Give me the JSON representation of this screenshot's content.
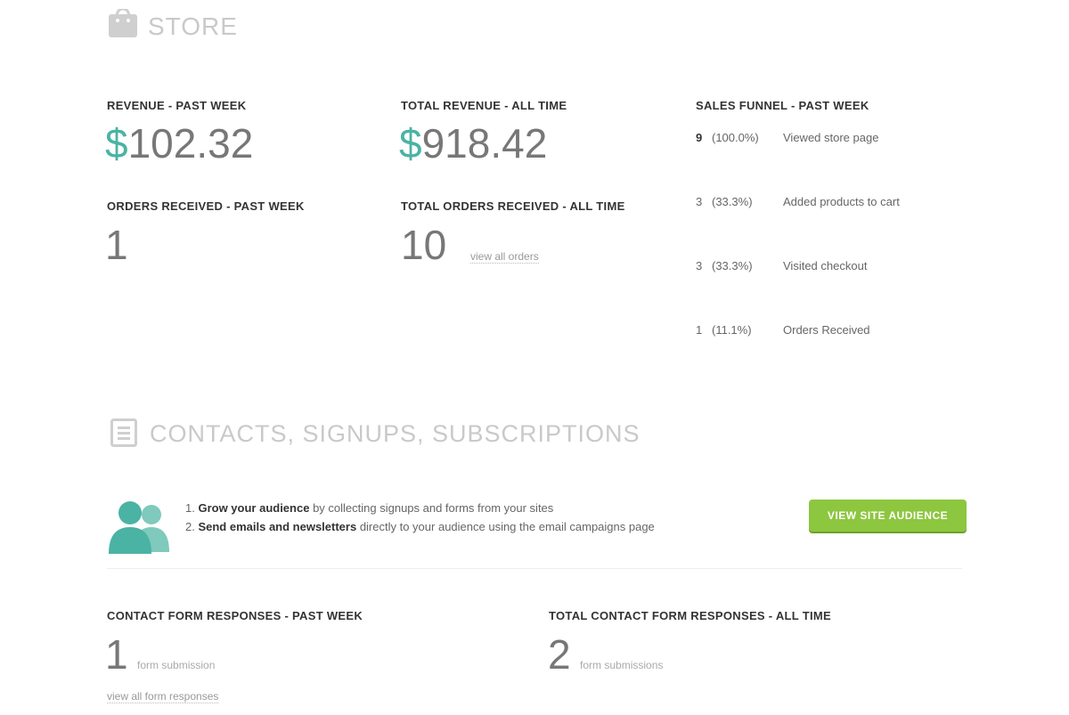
{
  "store": {
    "title": "STORE",
    "icon": "store-bag-icon",
    "revenue_week": {
      "label": "REVENUE - PAST WEEK",
      "currency": "$",
      "amount": "102.32"
    },
    "revenue_all": {
      "label": "TOTAL REVENUE - ALL TIME",
      "currency": "$",
      "amount": "918.42"
    },
    "orders_week": {
      "label": "ORDERS RECEIVED - PAST WEEK",
      "value": "1"
    },
    "orders_all": {
      "label": "TOTAL ORDERS RECEIVED - ALL TIME",
      "value": "10",
      "link": "view all orders"
    },
    "funnel": {
      "label": "SALES FUNNEL - PAST WEEK",
      "rows": [
        {
          "count": "9",
          "pct": "(100.0%)",
          "text": "Viewed store page"
        },
        {
          "count": "3",
          "pct": "(33.3%)",
          "text": "Added products to cart"
        },
        {
          "count": "3",
          "pct": "(33.3%)",
          "text": "Visited checkout"
        },
        {
          "count": "1",
          "pct": "(11.1%)",
          "text": "Orders Received"
        }
      ]
    }
  },
  "contacts": {
    "title": "CONTACTS, SIGNUPS, SUBSCRIPTIONS",
    "icon": "form-list-icon",
    "people_icon": "people-icon",
    "bullets": [
      {
        "num": "1.",
        "bold": "Grow your audience",
        "rest": " by collecting signups and forms from your sites"
      },
      {
        "num": "2.",
        "bold": "Send emails and newsletters",
        "rest": " directly to your audience using the email campaigns page"
      }
    ],
    "button": "VIEW SITE AUDIENCE",
    "responses_week": {
      "label": "CONTACT FORM RESPONSES - PAST WEEK",
      "value": "1",
      "sub": "form submission"
    },
    "responses_all": {
      "label": "TOTAL CONTACT FORM RESPONSES - ALL TIME",
      "value": "2",
      "sub": "form submissions"
    },
    "view_link": "view all form responses"
  },
  "colors": {
    "accent": "#4bb3a4",
    "button": "#8dc63f"
  }
}
